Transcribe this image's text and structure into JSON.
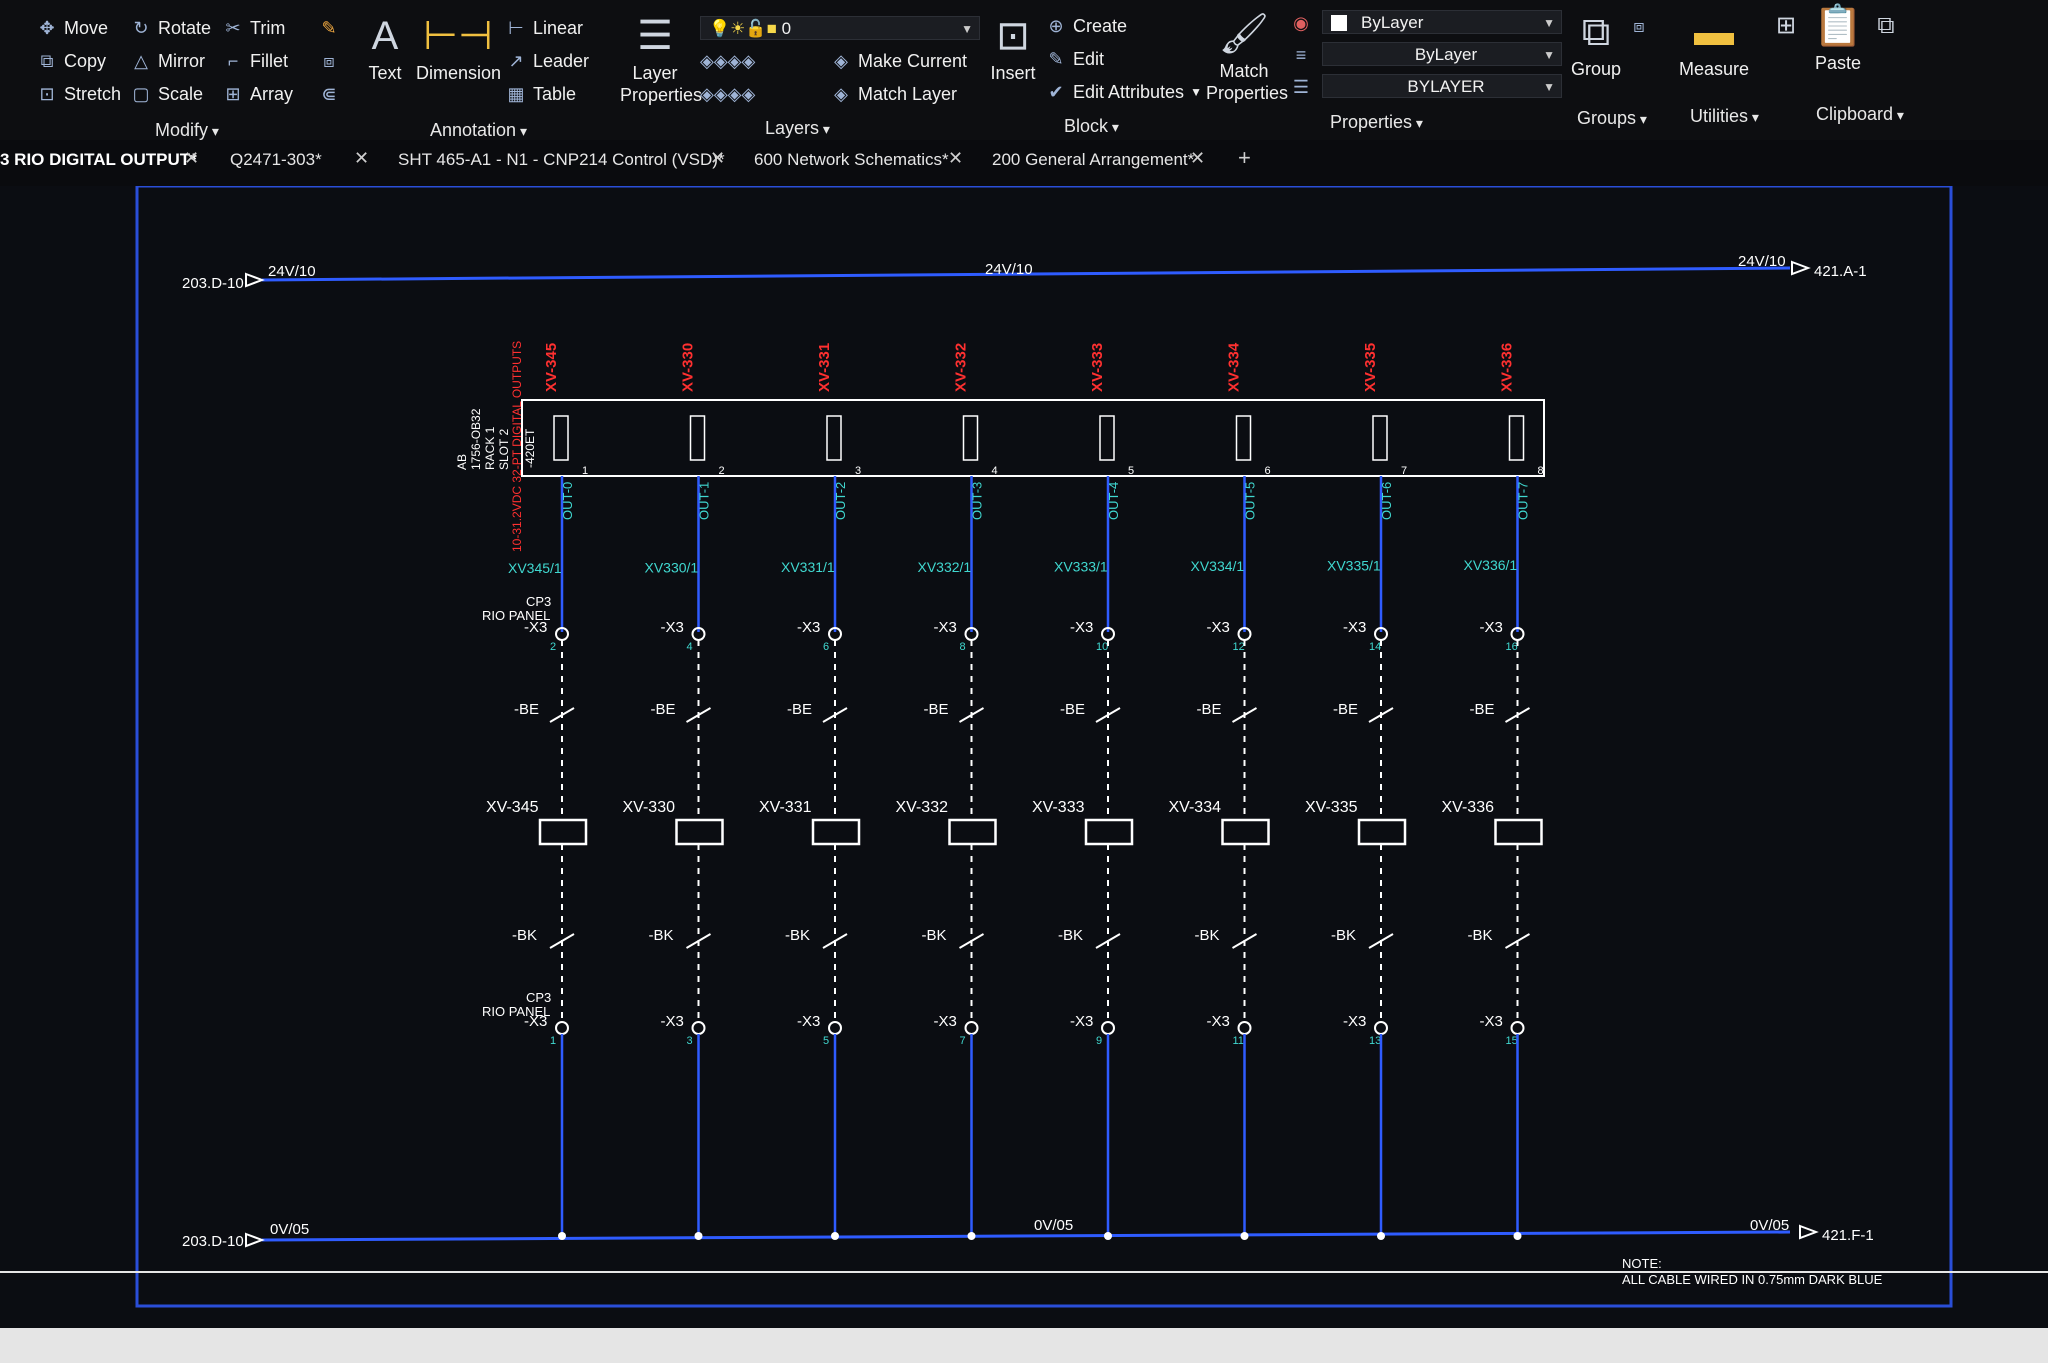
{
  "ribbon": {
    "modify": {
      "move": "Move",
      "copy": "Copy",
      "stretch": "Stretch",
      "rotate": "Rotate",
      "mirror": "Mirror",
      "scale": "Scale",
      "trim": "Trim",
      "fillet": "Fillet",
      "array": "Array",
      "group": "Modify"
    },
    "annotation": {
      "text": "Text",
      "dimension": "Dimension",
      "linear": "Linear",
      "leader": "Leader",
      "table": "Table",
      "group": "Annotation"
    },
    "layers": {
      "layer_properties": "Layer Properties",
      "current_layer": "0",
      "make_current": "Make Current",
      "match_layer": "Match Layer",
      "group": "Layers"
    },
    "block": {
      "insert": "Insert",
      "create": "Create",
      "edit": "Edit",
      "edit_attributes": "Edit Attributes",
      "group": "Block"
    },
    "properties": {
      "match_properties": "Match Properties",
      "color": "ByLayer",
      "linetype": "ByLayer",
      "lineweight": "BYLAYER",
      "group": "Properties"
    },
    "groups": {
      "group": "Group",
      "label": "Groups"
    },
    "utilities": {
      "measure": "Measure",
      "label": "Utilities"
    },
    "clipboard": {
      "paste": "Paste",
      "label": "Clipboard"
    }
  },
  "tabs": [
    {
      "label": "3 RIO DIGITAL OUTPUT*",
      "active": true
    },
    {
      "label": "Q2471-303*",
      "active": false
    },
    {
      "label": "SHT 465-A1 - N1 - CNP214 Control (VSD)*",
      "active": false
    },
    {
      "label": "600 Network Schematics*",
      "active": false
    },
    {
      "label": "200 General Arrangement*",
      "active": false
    }
  ],
  "drawing": {
    "top_rail": {
      "left_ref": "203.D-10",
      "left_label": "24V/10",
      "mid_label": "24V/10",
      "right_label": "24V/10",
      "right_ref": "421.A-1"
    },
    "bottom_rail": {
      "left_ref": "203.D-10",
      "left_label": "0V/05",
      "mid_label": "0V/05",
      "right_label": "0V/05",
      "right_ref": "421.F-1"
    },
    "module": {
      "line1": "AB",
      "line2": "1756-OB32",
      "line3": "RACK 1",
      "line4": "SLOT 2",
      "title": "10-31.2VDC 32-PT DIGITAL OUTPUTS",
      "ref": "-420ET"
    },
    "panel_label": "CP3",
    "panel_label2": "RIO PANEL",
    "be_label": "-BE",
    "bk_label": "-BK",
    "x3_label": "-X3",
    "channels": [
      {
        "tag": "XV-345",
        "wire": "XV345/1",
        "out": "OUT-0",
        "term_top": "2",
        "term_bot": "1",
        "pin": "1"
      },
      {
        "tag": "XV-330",
        "wire": "XV330/1",
        "out": "OUT-1",
        "term_top": "4",
        "term_bot": "3",
        "pin": "2"
      },
      {
        "tag": "XV-331",
        "wire": "XV331/1",
        "out": "OUT-2",
        "term_top": "6",
        "term_bot": "5",
        "pin": "3"
      },
      {
        "tag": "XV-332",
        "wire": "XV332/1",
        "out": "OUT-3",
        "term_top": "8",
        "term_bot": "7",
        "pin": "4"
      },
      {
        "tag": "XV-333",
        "wire": "XV333/1",
        "out": "OUT-4",
        "term_top": "10",
        "term_bot": "9",
        "pin": "5"
      },
      {
        "tag": "XV-334",
        "wire": "XV334/1",
        "out": "OUT-5",
        "term_top": "12",
        "term_bot": "11",
        "pin": "6"
      },
      {
        "tag": "XV-335",
        "wire": "XV335/1",
        "out": "OUT-6",
        "term_top": "14",
        "term_bot": "13",
        "pin": "7"
      },
      {
        "tag": "XV-336",
        "wire": "XV336/1",
        "out": "OUT-7",
        "term_top": "16",
        "term_bot": "15",
        "pin": "8"
      }
    ],
    "note_title": "NOTE:",
    "note_text": "ALL CABLE WIRED IN 0.75mm DARK BLUE"
  }
}
